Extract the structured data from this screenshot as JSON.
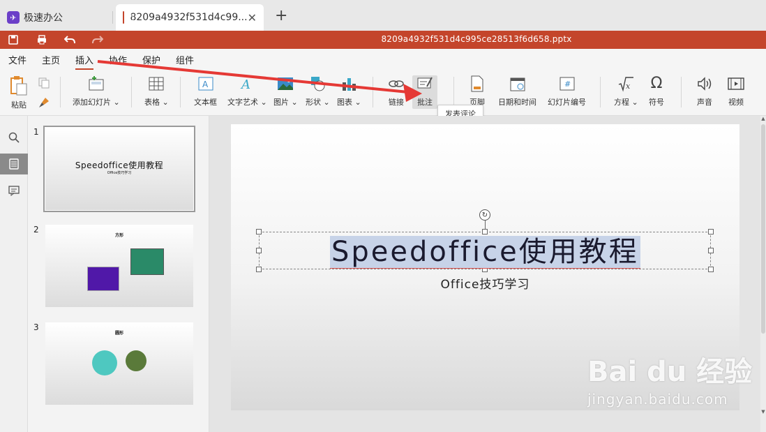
{
  "tabs": [
    {
      "label": "极速办公"
    },
    {
      "label": "8209a4932f531d4c99..."
    }
  ],
  "titlebar": {
    "filename": "8209a4932f531d4c995ce28513f6d658.pptx"
  },
  "menu": [
    "文件",
    "主页",
    "插入",
    "协作",
    "保护",
    "组件"
  ],
  "active_menu": "插入",
  "ribbon": {
    "paste": "粘贴",
    "add_slide": "添加幻灯片",
    "table": "表格",
    "textbox": "文本框",
    "wordart": "文字艺术",
    "image": "图片",
    "shape": "形状",
    "chart": "图表",
    "link": "链接",
    "comment": "批注",
    "footer": "页脚",
    "datetime": "日期和时间",
    "slide_number": "幻灯片编号",
    "equation": "方程",
    "symbol": "符号",
    "audio": "声音",
    "video": "视频"
  },
  "tooltip": "发表评论",
  "slides": [
    {
      "num": "1",
      "title": "Speedoffice使用教程",
      "subtitle": "Office技巧学习"
    },
    {
      "num": "2",
      "title": "方形"
    },
    {
      "num": "3",
      "title": "圆形"
    }
  ],
  "canvas": {
    "title": "Speedoffice使用教程",
    "subtitle": "Office技巧学习"
  },
  "watermark": {
    "main": "Bai du 经验",
    "sub": "jingyan.baidu.com"
  },
  "colors": {
    "accent": "#c4452b",
    "purple_square": "#5018a8",
    "green_square": "#2a8a68",
    "teal_circle": "#4ec8c0",
    "olive_circle": "#5a7a3a"
  }
}
